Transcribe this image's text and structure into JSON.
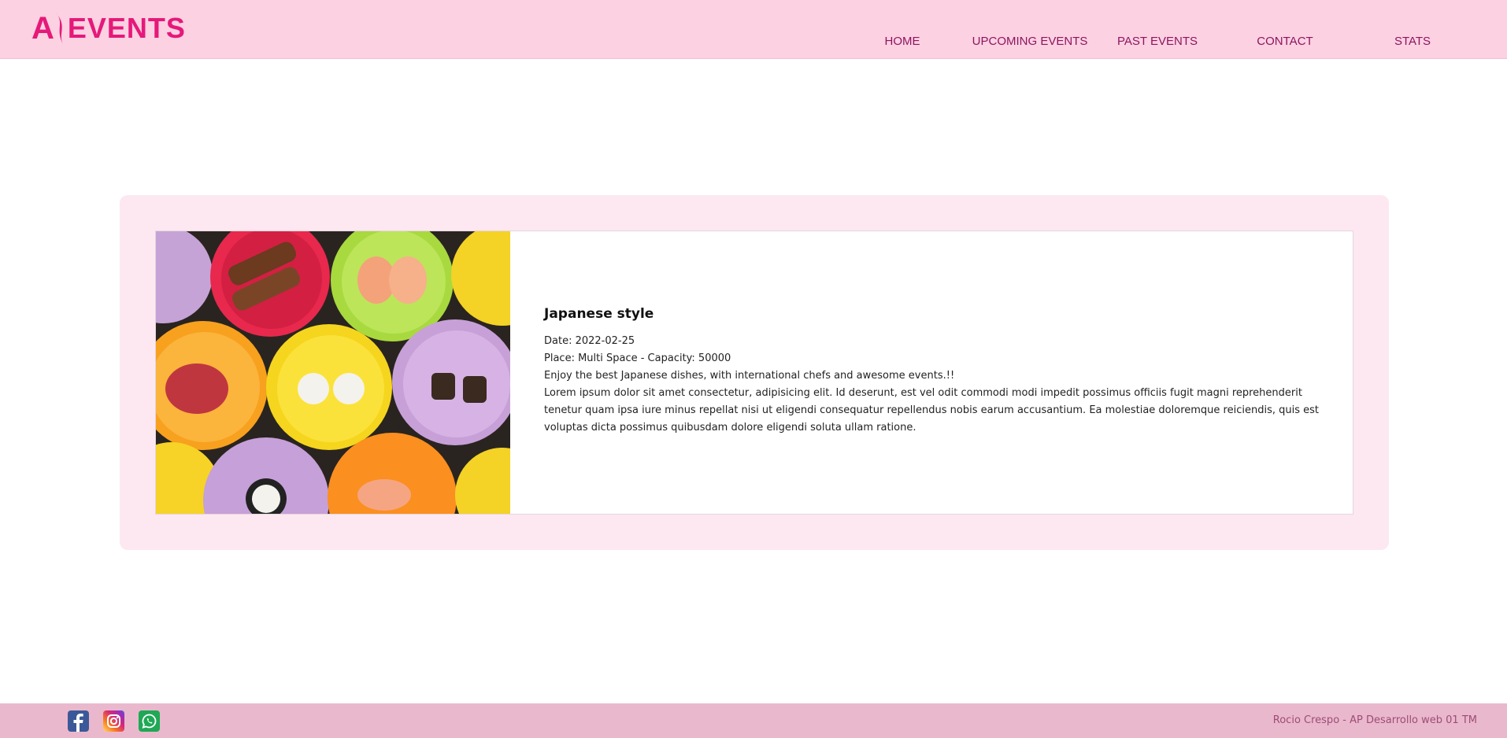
{
  "navbar": {
    "logo_letter": "A",
    "logo_text": "EVENTS",
    "brand_color": "#e5197a",
    "links": [
      {
        "label": "HOME"
      },
      {
        "label": "UPCOMING EVENTS"
      },
      {
        "label": "PAST EVENTS"
      },
      {
        "label": "CONTACT"
      },
      {
        "label": "STATS"
      }
    ]
  },
  "event": {
    "image_icon": "sushi-plates-photo",
    "title": "Japanese style",
    "date_line": "Date: 2022-02-25",
    "place_line": "Place: Multi Space - Capacity: 50000",
    "description": "Enjoy the best Japanese dishes, with international chefs and awesome events.!!",
    "lorem": "Lorem ipsum dolor sit amet consectetur, adipisicing elit. Id deserunt, est vel odit commodi modi impedit possimus officiis fugit magni reprehenderit tenetur quam ipsa iure minus repellat nisi ut eligendi consequatur repellendus nobis earum accusantium. Ea molestiae doloremque reiciendis, quis est voluptas dicta possimus quibusdam dolore eligendi soluta ullam ratione."
  },
  "footer": {
    "social_icons": [
      "facebook-icon",
      "instagram-icon",
      "whatsapp-icon"
    ],
    "credit": "Rocio Crespo - AP Desarrollo web 01 TM"
  }
}
